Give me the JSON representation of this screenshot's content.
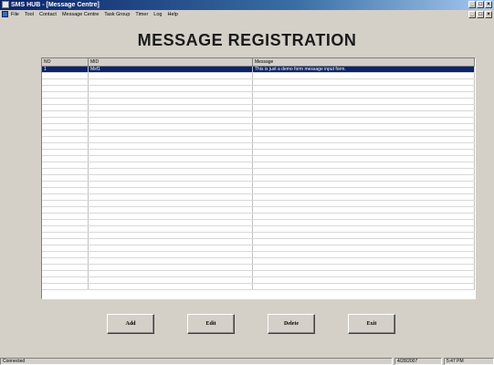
{
  "window": {
    "title": "SMS HUB - [Message Centre]"
  },
  "menu": {
    "items": [
      "File",
      "Tool",
      "Contact",
      "Message Centre",
      "Task Group",
      "Timer",
      "Log",
      "Help"
    ]
  },
  "page": {
    "heading": "MESSAGE REGISTRATION"
  },
  "table": {
    "columns": [
      "NO",
      "MID",
      "Message"
    ],
    "rows": [
      [
        "1",
        "Msf1",
        "This is just a demo form message input form."
      ]
    ]
  },
  "buttons": {
    "add": "Add",
    "edit": "Edit",
    "delete": "Delete",
    "exit": "Exit"
  },
  "status": {
    "left": "Connected",
    "date": "4/28/2007",
    "time": "5:47 PM"
  },
  "colors": {
    "title_active": "#0a246a",
    "selection": "#0a246a",
    "face": "#d4d0c8"
  }
}
